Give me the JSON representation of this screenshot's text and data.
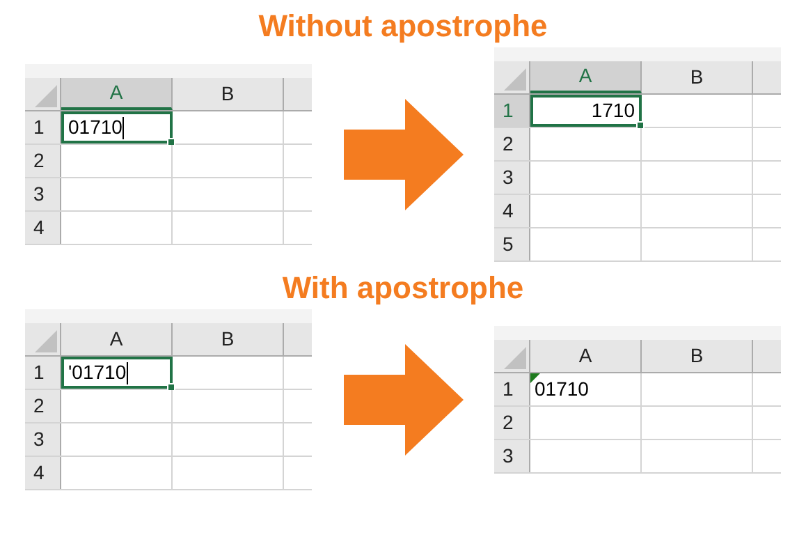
{
  "sections": [
    {
      "title": "Without apostrophe",
      "before": {
        "columns": [
          {
            "label": "A",
            "selected": true
          },
          {
            "label": "B",
            "selected": false
          }
        ],
        "rows": [
          {
            "header": "1",
            "selected": false,
            "cell": {
              "text": "01710",
              "kind": "text",
              "selected": true,
              "editing": true,
              "flag": false
            }
          },
          {
            "header": "2",
            "selected": false
          },
          {
            "header": "3",
            "selected": false
          },
          {
            "header": "4",
            "selected": false
          }
        ]
      },
      "after": {
        "columns": [
          {
            "label": "A",
            "selected": true
          },
          {
            "label": "B",
            "selected": false
          }
        ],
        "rows": [
          {
            "header": "1",
            "selected": true,
            "cell": {
              "text": "1710",
              "kind": "number",
              "selected": true,
              "editing": false,
              "flag": false
            }
          },
          {
            "header": "2",
            "selected": false
          },
          {
            "header": "3",
            "selected": false
          },
          {
            "header": "4",
            "selected": false
          },
          {
            "header": "5",
            "selected": false
          }
        ]
      }
    },
    {
      "title": "With apostrophe",
      "before": {
        "columns": [
          {
            "label": "A",
            "selected": false
          },
          {
            "label": "B",
            "selected": false
          }
        ],
        "rows": [
          {
            "header": "1",
            "selected": false,
            "cell": {
              "text": "'01710",
              "kind": "text",
              "selected": true,
              "editing": true,
              "flag": false
            }
          },
          {
            "header": "2",
            "selected": false
          },
          {
            "header": "3",
            "selected": false
          },
          {
            "header": "4",
            "selected": false
          }
        ]
      },
      "after": {
        "columns": [
          {
            "label": "A",
            "selected": false
          },
          {
            "label": "B",
            "selected": false
          }
        ],
        "rows": [
          {
            "header": "1",
            "selected": false,
            "cell": {
              "text": "01710",
              "kind": "text",
              "selected": false,
              "editing": false,
              "flag": true
            }
          },
          {
            "header": "2",
            "selected": false
          },
          {
            "header": "3",
            "selected": false
          }
        ]
      }
    }
  ]
}
